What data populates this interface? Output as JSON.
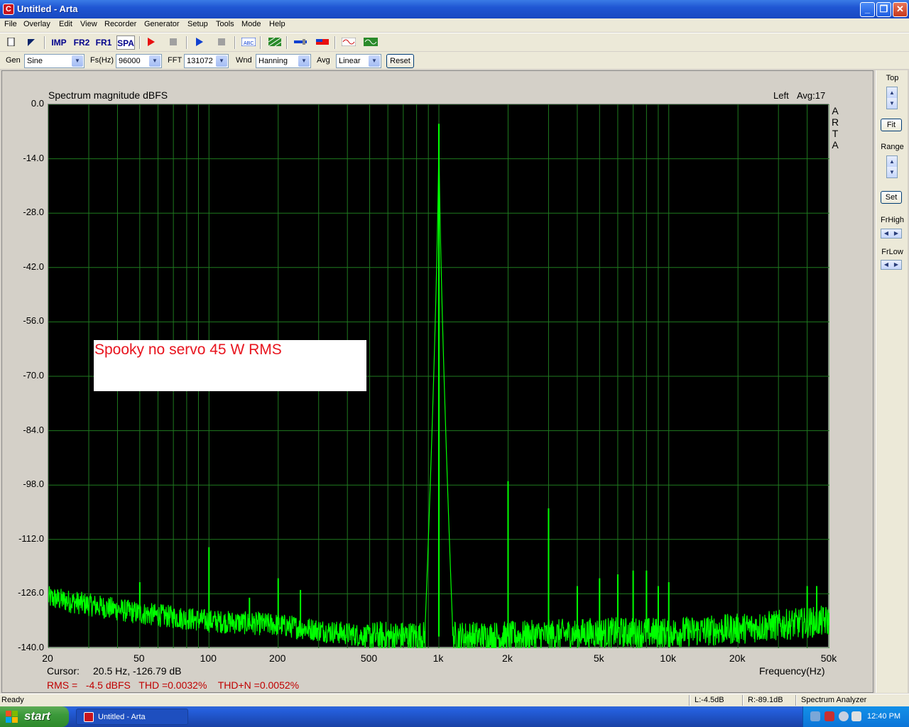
{
  "window": {
    "title": "Untitled - Arta",
    "app_icon": "C"
  },
  "menu": [
    "File",
    "Overlay",
    "Edit",
    "View",
    "Recorder",
    "Generator",
    "Setup",
    "Tools",
    "Mode",
    "Help"
  ],
  "toolbar": {
    "imp": "IMP",
    "fr2": "FR2",
    "fr1": "FR1",
    "spa": "SPA"
  },
  "controls": {
    "gen_label": "Gen",
    "gen_value": "Sine",
    "fs_label": "Fs(Hz)",
    "fs_value": "96000",
    "fft_label": "FFT",
    "fft_value": "131072",
    "wnd_label": "Wnd",
    "wnd_value": "Hanning",
    "avg_label": "Avg",
    "avg_value": "Linear",
    "reset_label": "Reset"
  },
  "plot": {
    "title": "Spectrum magnitude dBFS",
    "channel": "Left",
    "avg": "Avg:17",
    "watermark": "ARTA",
    "annotation": "Spooky no servo  45 W RMS",
    "xaxis_label": "Frequency(Hz)",
    "cursor_label": "Cursor:",
    "cursor_value": "20.5 Hz, -126.79 dB",
    "measurements": "RMS =   -4.5 dBFS   THD =0.0032%    THD+N =0.0052%"
  },
  "right_panel": {
    "top_label": "Top",
    "fit_label": "Fit",
    "range_label": "Range",
    "set_label": "Set",
    "frhigh_label": "FrHigh",
    "frlow_label": "FrLow"
  },
  "status": {
    "left": "Ready",
    "l_level": "L:-4.5dB",
    "r_level": "R:-89.1dB",
    "mode": "Spectrum Analyzer"
  },
  "taskbar": {
    "start": "start",
    "task": "Untitled - Arta",
    "clock": "12:40 PM"
  },
  "colors": {
    "trace": "#00ff00",
    "grid": "#1f7a1f",
    "annotation_text": "#e8141e",
    "measurement_text": "#c00000"
  },
  "chart_data": {
    "type": "line",
    "title": "Spectrum magnitude dBFS",
    "xlabel": "Frequency(Hz)",
    "ylabel": "",
    "xscale": "log",
    "xlim": [
      20,
      50000
    ],
    "ylim": [
      -140,
      0
    ],
    "yticks": [
      "0.0",
      "-14.0",
      "-28.0",
      "-42.0",
      "-56.0",
      "-70.0",
      "-84.0",
      "-98.0",
      "-112.0",
      "-126.0",
      "-140.0"
    ],
    "xticks": [
      "20",
      "50",
      "100",
      "200",
      "500",
      "1k",
      "2k",
      "5k",
      "10k",
      "20k",
      "50k"
    ],
    "grid": true,
    "series": [
      {
        "peaks": [
          {
            "x": 50,
            "y": -123
          },
          {
            "x": 100,
            "y": -114
          },
          {
            "x": 150,
            "y": -127
          },
          {
            "x": 200,
            "y": -122
          },
          {
            "x": 250,
            "y": -125
          },
          {
            "x": 1000,
            "y": -5
          },
          {
            "x": 2000,
            "y": -97
          },
          {
            "x": 3000,
            "y": -104
          },
          {
            "x": 4000,
            "y": -124
          },
          {
            "x": 5000,
            "y": -122
          },
          {
            "x": 6000,
            "y": -121
          },
          {
            "x": 7000,
            "y": -120
          },
          {
            "x": 8000,
            "y": -120
          },
          {
            "x": 9000,
            "y": -124
          },
          {
            "x": 10000,
            "y": -123
          },
          {
            "x": 40000,
            "y": -124
          },
          {
            "x": 44000,
            "y": -124
          }
        ],
        "noise_floor": [
          {
            "x": 20,
            "y": -127
          },
          {
            "x": 50,
            "y": -131
          },
          {
            "x": 100,
            "y": -133
          },
          {
            "x": 200,
            "y": -134
          },
          {
            "x": 500,
            "y": -137
          },
          {
            "x": 1000,
            "y": -137
          },
          {
            "x": 2000,
            "y": -137
          },
          {
            "x": 5000,
            "y": -136
          },
          {
            "x": 10000,
            "y": -136
          },
          {
            "x": 20000,
            "y": -135
          },
          {
            "x": 48000,
            "y": -133
          }
        ]
      }
    ]
  }
}
